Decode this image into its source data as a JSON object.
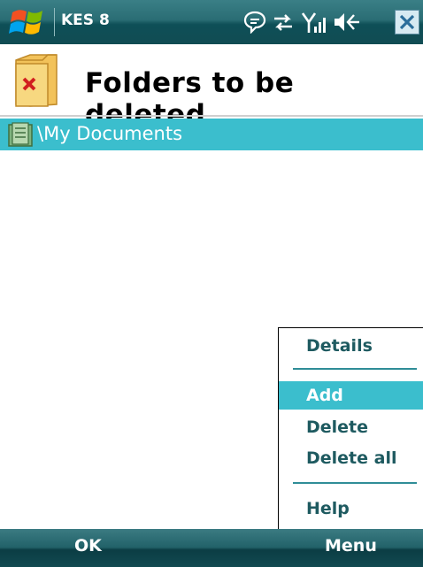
{
  "statusbar": {
    "app_name": "KES 8",
    "icons": [
      "windows-start-icon",
      "message-icon",
      "sync-icon",
      "signal-icon",
      "volume-icon",
      "close-icon"
    ]
  },
  "header": {
    "title": "Folders to be deleted",
    "icon": "folder-delete-icon"
  },
  "list": {
    "items": [
      {
        "label": "\\My Documents",
        "icon": "folder-icon",
        "selected": true
      }
    ]
  },
  "menu": {
    "items": [
      {
        "label": "Details",
        "selected": false
      },
      {
        "label": "Add",
        "selected": true
      },
      {
        "label": "Delete",
        "selected": false
      },
      {
        "label": "Delete all",
        "selected": false
      },
      {
        "label": "Help",
        "selected": false
      }
    ]
  },
  "softkeys": {
    "left": "OK",
    "right": "Menu"
  },
  "colors": {
    "accent": "#3bbecd",
    "bar": "#2a6d74",
    "menu_text": "#1e5a60"
  }
}
